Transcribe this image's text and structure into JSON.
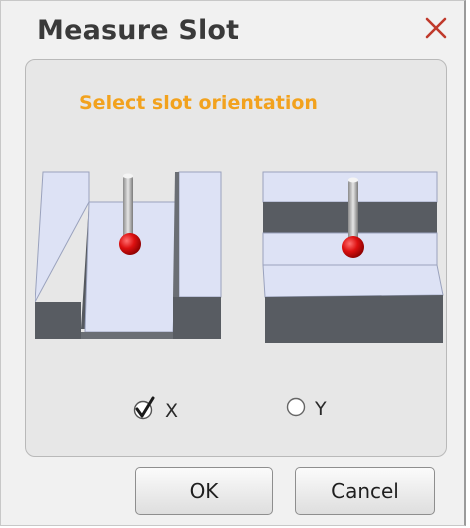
{
  "dialog": {
    "title": "Measure Slot",
    "close_icon": "close-x-icon",
    "close_color": "#c0392b"
  },
  "orientation": {
    "prompt": "Select slot orientation",
    "prompt_color": "#f2a21e",
    "options": [
      {
        "label": "X",
        "selected": true,
        "control": "checkbox"
      },
      {
        "label": "Y",
        "selected": false,
        "control": "radio"
      }
    ]
  },
  "buttons": {
    "ok_label": "OK",
    "cancel_label": "Cancel"
  },
  "illustrations": {
    "x_slot": "slot-along-x-icon",
    "y_slot": "slot-along-y-icon",
    "probe_tip_color": "#d01010"
  }
}
